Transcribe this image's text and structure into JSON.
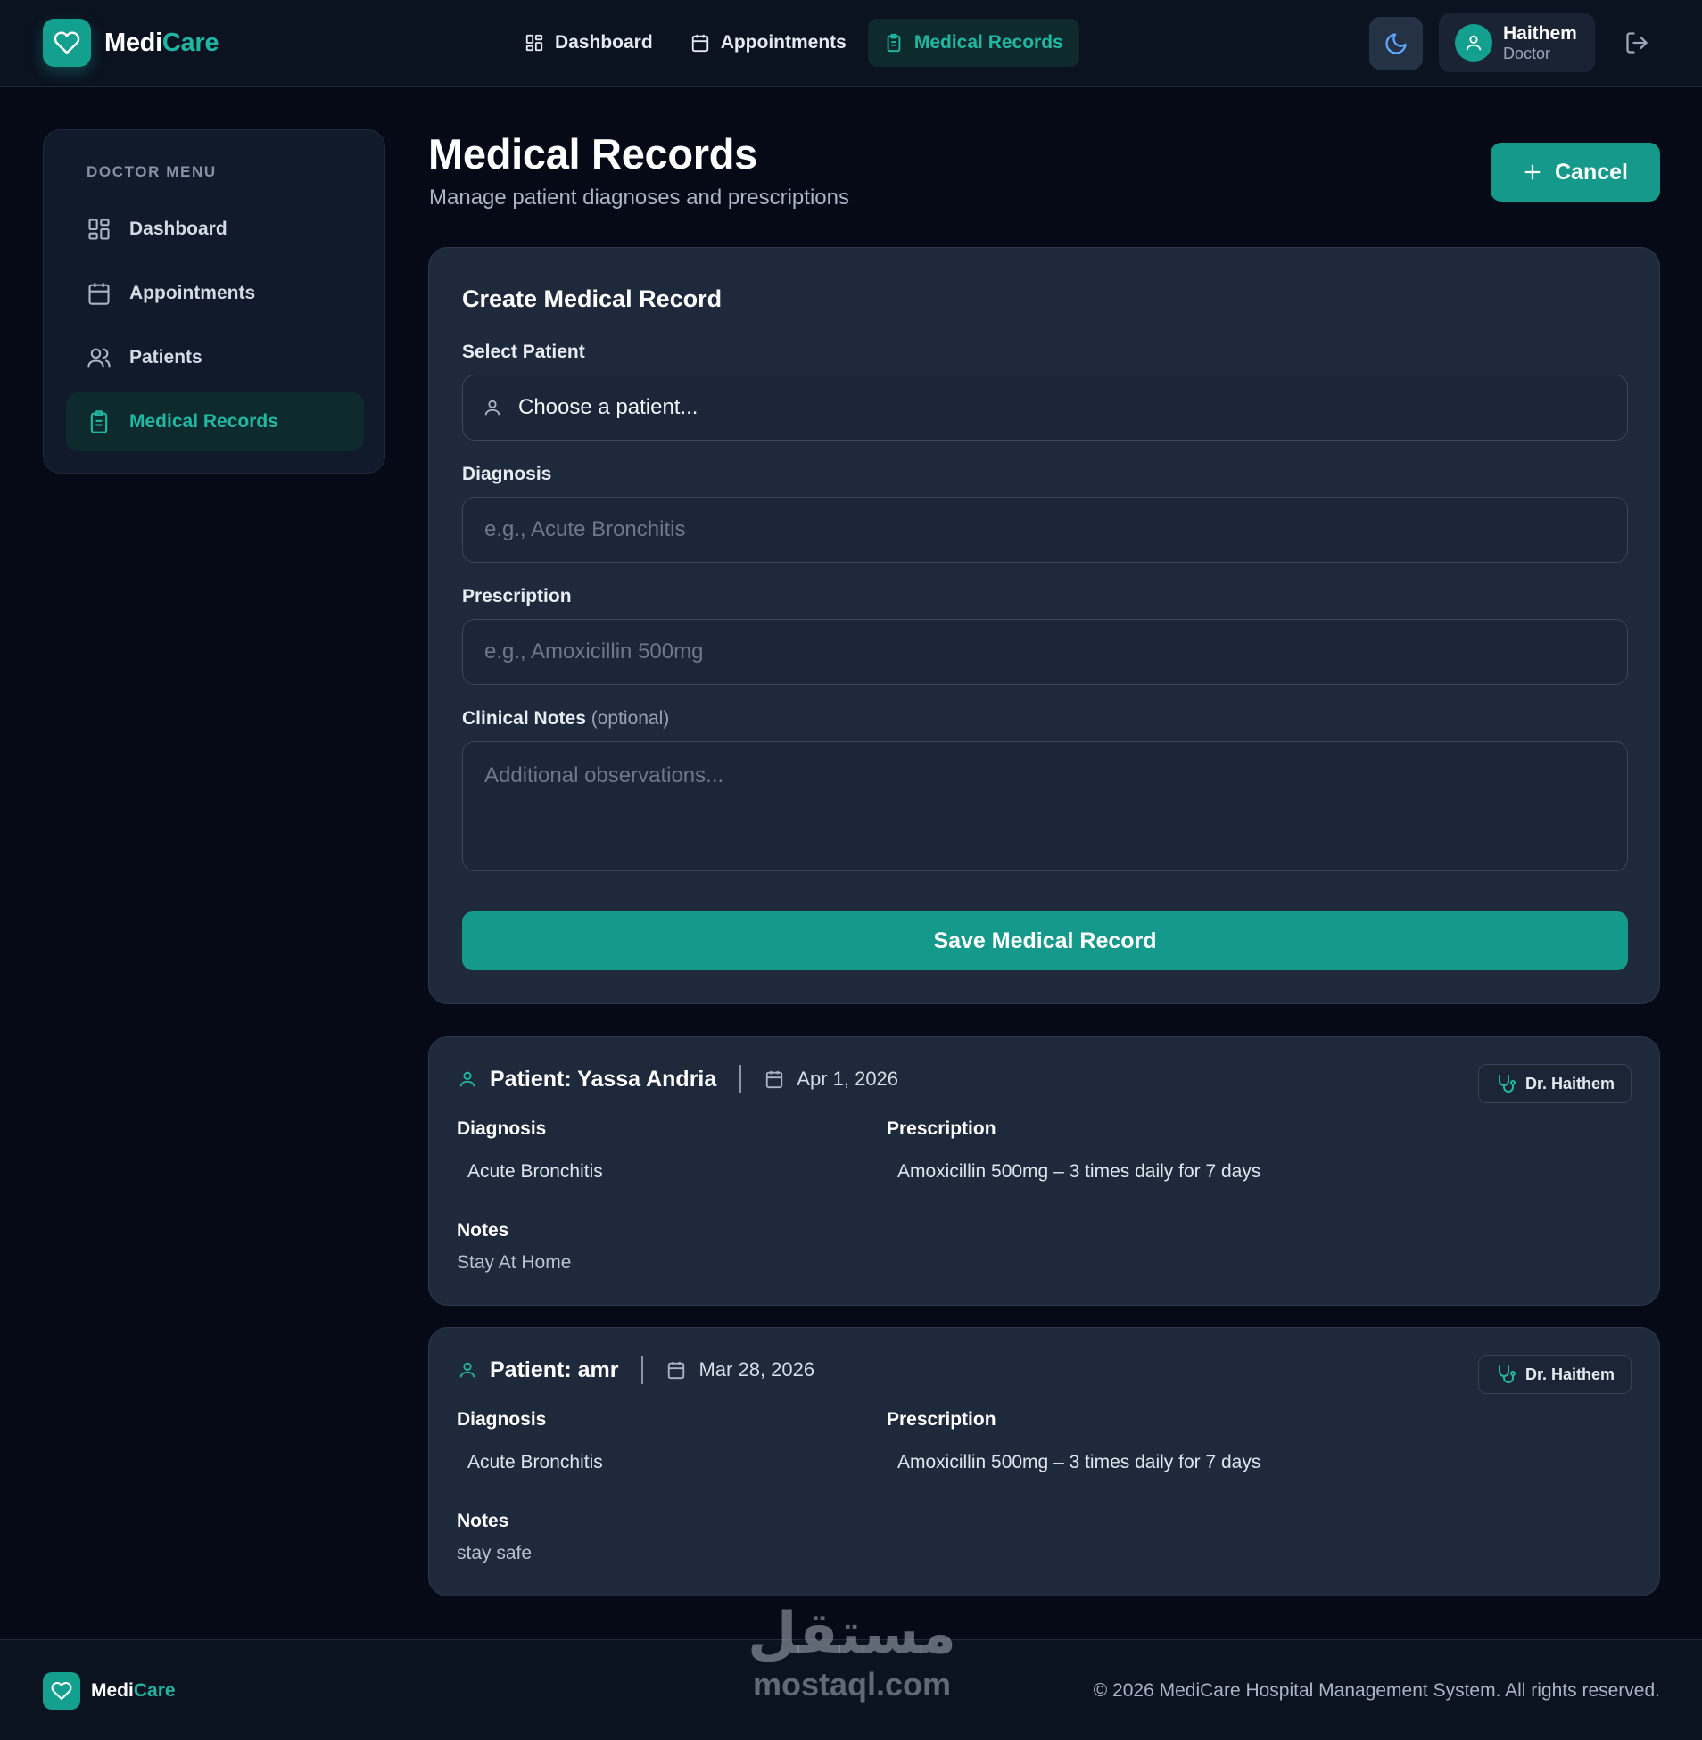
{
  "brand": {
    "name_part1": "Medi",
    "name_part2": "Care"
  },
  "topnav": {
    "items": [
      {
        "label": "Dashboard",
        "icon": "grid-icon"
      },
      {
        "label": "Appointments",
        "icon": "calendar-icon"
      },
      {
        "label": "Medical Records",
        "icon": "clipboard-icon",
        "active": true
      }
    ]
  },
  "user": {
    "name": "Haithem",
    "role": "Doctor"
  },
  "sidebar": {
    "heading": "DOCTOR MENU",
    "items": [
      {
        "label": "Dashboard",
        "icon": "grid-icon"
      },
      {
        "label": "Appointments",
        "icon": "calendar-icon"
      },
      {
        "label": "Patients",
        "icon": "users-icon"
      },
      {
        "label": "Medical Records",
        "icon": "clipboard-icon",
        "active": true
      }
    ]
  },
  "page": {
    "title": "Medical Records",
    "subtitle": "Manage patient diagnoses and prescriptions",
    "cancel_label": "Cancel"
  },
  "form": {
    "title": "Create Medical Record",
    "patient_label": "Select Patient",
    "patient_value": "Choose a patient...",
    "diagnosis_label": "Diagnosis",
    "diagnosis_placeholder": "e.g., Acute Bronchitis",
    "prescription_label": "Prescription",
    "prescription_placeholder": "e.g., Amoxicillin 500mg",
    "notes_label": "Clinical Notes",
    "notes_optional": "(optional)",
    "notes_placeholder": "Additional observations...",
    "save_label": "Save Medical Record"
  },
  "records": [
    {
      "patient": "Patient: Yassa Andria",
      "date": "Apr 1, 2026",
      "doctor": "Dr. Haithem",
      "diagnosis_label": "Diagnosis",
      "diagnosis": "Acute Bronchitis",
      "prescription_label": "Prescription",
      "prescription": "Amoxicillin 500mg – 3 times daily for 7 days",
      "notes_label": "Notes",
      "notes": "Stay At Home"
    },
    {
      "patient": "Patient: amr",
      "date": "Mar 28, 2026",
      "doctor": "Dr. Haithem",
      "diagnosis_label": "Diagnosis",
      "diagnosis": "Acute Bronchitis",
      "prescription_label": "Prescription",
      "prescription": "Amoxicillin 500mg – 3 times daily for 7 days",
      "notes_label": "Notes",
      "notes": "stay safe"
    }
  ],
  "footer": {
    "copyright": "© 2026 MediCare Hospital Management System. All rights reserved."
  },
  "watermark": {
    "arabic": "مستقل",
    "latin": "mostaql.com"
  },
  "colors": {
    "accent": "#14998a",
    "accent_text": "#21b8a3",
    "background": "#050a16",
    "card": "#1e293b"
  }
}
